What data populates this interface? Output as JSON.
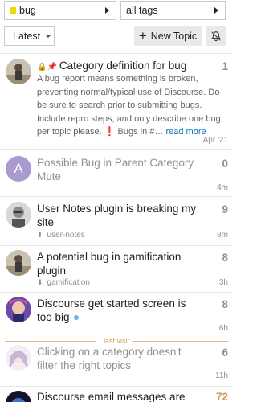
{
  "filters": {
    "category": {
      "label": "bug",
      "color": "#e9dd00"
    },
    "tags": {
      "label": "all tags"
    }
  },
  "nav": {
    "sort_label": "Latest",
    "new_topic_label": "New Topic"
  },
  "topics": [
    {
      "title": "Category definition for bug",
      "excerpt_parts": {
        "text": "A bug report means something is broken, preventing normal/typical use of Discourse. Do be sure to search prior to submitting bugs. Include repro steps, and only describe one bug per topic please. ",
        "bang": "❗",
        "text2": " Bugs in #…",
        "read_more": "read more"
      },
      "count": "1",
      "age": "Apr '21"
    },
    {
      "title": "Possible Bug in Parent Category Mute",
      "avatar_letter": "A",
      "count": "0",
      "age": "4m"
    },
    {
      "title": "User Notes plugin is breaking my site",
      "tag": "user-notes",
      "count": "9",
      "age": "8m"
    },
    {
      "title": "A potential bug in gamification plugin",
      "tag": "gamification",
      "count": "8",
      "age": "3h"
    },
    {
      "title": "Discourse get started screen is too big",
      "count": "8",
      "age": "6h"
    },
    {
      "title": "Clicking on a category doesn't filter the right topics",
      "count": "6",
      "age": "11h"
    },
    {
      "title": "Discourse email messages are",
      "count": "72"
    }
  ],
  "last_visit_label": "last visit",
  "colors": {
    "link": "#0e77b7",
    "hot_count": "#cf9a4f",
    "new_dot": "#64b5f6"
  }
}
